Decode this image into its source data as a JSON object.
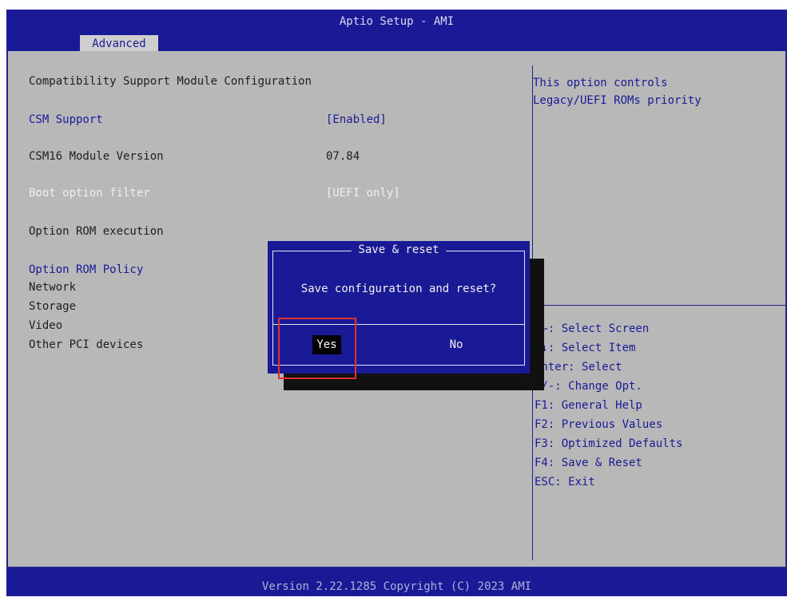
{
  "header": {
    "title": "Aptio Setup - AMI",
    "active_tab": "Advanced"
  },
  "main": {
    "section_title": "Compatibility Support Module Configuration",
    "items": [
      {
        "label": "CSM Support",
        "value": "[Enabled]"
      },
      {
        "label": "CSM16 Module Version",
        "value": "07.84"
      },
      {
        "label": "Boot option filter",
        "value": "[UEFI only]"
      }
    ],
    "option_rom_execution": "Option ROM execution",
    "option_rom_policy": "Option ROM Policy",
    "rom_items": [
      "Network",
      "Storage",
      "Video",
      "Other PCI devices"
    ]
  },
  "help": {
    "text": "This option controls\nLegacy/UEFI ROMs priority"
  },
  "keys": [
    "→←: Select Screen",
    "↑↓: Select Item",
    "Enter: Select",
    "+/-: Change Opt.",
    "F1: General Help",
    "F2: Previous Values",
    "F3: Optimized Defaults",
    "F4: Save & Reset",
    "ESC: Exit"
  ],
  "dialog": {
    "title": "Save & reset",
    "message": "Save configuration and reset?",
    "yes": "Yes",
    "no": "No"
  },
  "footer": {
    "version": "Version 2.22.1285 Copyright (C) 2023 AMI"
  },
  "colors": {
    "bios_blue": "#1a1a96",
    "panel_gray": "#b8b8b8",
    "highlight_red": "#e03030"
  }
}
